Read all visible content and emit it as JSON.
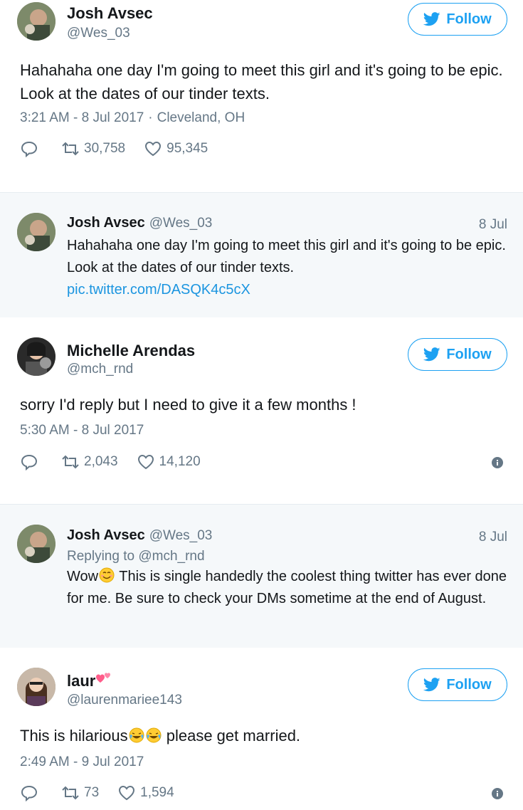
{
  "tweet1": {
    "name": "Josh Avsec",
    "handle": "@Wes_03",
    "follow_label": "Follow",
    "text": "Hahahaha one day I'm going to meet this girl and it's going to be epic. Look at the dates of our tinder texts.",
    "time": "3:21 AM - 8 Jul 2017",
    "location": "Cleveland, OH",
    "retweets": "30,758",
    "likes": "95,345"
  },
  "quote1": {
    "name": "Josh Avsec",
    "handle": "@Wes_03",
    "date": "8 Jul",
    "text": "Hahahaha one day I'm going to meet this girl and it's going to be epic. Look at the dates of our tinder texts.",
    "link": "pic.twitter.com/DASQK4c5cX"
  },
  "tweet2": {
    "name": "Michelle Arendas",
    "handle": "@mch_rnd",
    "follow_label": "Follow",
    "text": "sorry I'd reply but I need to give it a few months !",
    "time": "5:30 AM - 8 Jul 2017",
    "retweets": "2,043",
    "likes": "14,120"
  },
  "quote2": {
    "name": "Josh Avsec",
    "handle": "@Wes_03",
    "date": "8 Jul",
    "replying_prefix": "Replying to",
    "replying_to": "@mch_rnd",
    "text_start": "Wow",
    "text_rest": " This is single handedly the coolest thing twitter has ever done for me. Be sure to check your DMs sometime at the end of August."
  },
  "tweet3": {
    "name": "laur",
    "handle": "@laurenmariee143",
    "follow_label": "Follow",
    "text_start": "This is hilarious",
    "text_end": " please get married.",
    "time": "2:49 AM - 9 Jul 2017",
    "retweets": "73",
    "likes": "1,594"
  },
  "colors": {
    "twitter_blue": "#1da1f2",
    "link_blue": "#1b95e0",
    "secondary_text": "#657786",
    "quoted_bg": "#f5f8fa"
  },
  "icons": [
    "twitter-bird-icon",
    "reply-icon",
    "retweet-icon",
    "like-icon",
    "info-icon",
    "smiling-face-icon",
    "crying-laughing-face-icon",
    "heart-emoji-icon"
  ]
}
